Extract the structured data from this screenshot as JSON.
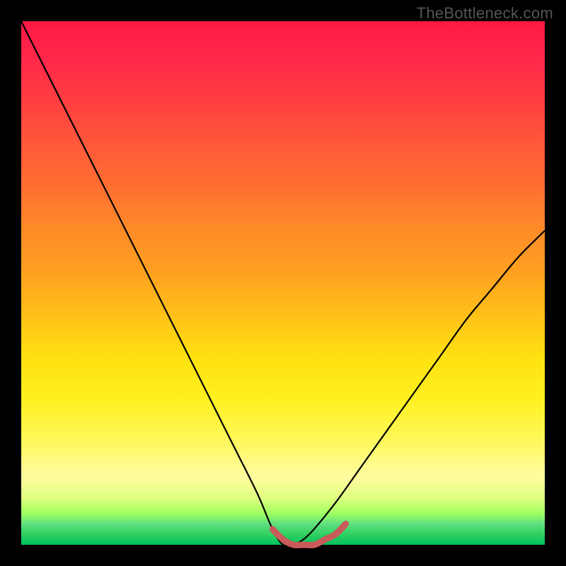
{
  "watermark": "TheBottleneck.com",
  "chart_data": {
    "type": "line",
    "title": "",
    "xlabel": "",
    "ylabel": "",
    "xlim": [
      0,
      1
    ],
    "ylim": [
      0,
      1
    ],
    "grid": false,
    "series": [
      {
        "name": "main-curve",
        "color": "#000000",
        "x": [
          0.0,
          0.05,
          0.1,
          0.15,
          0.2,
          0.25,
          0.3,
          0.35,
          0.4,
          0.45,
          0.48,
          0.5,
          0.52,
          0.55,
          0.6,
          0.65,
          0.7,
          0.75,
          0.8,
          0.85,
          0.9,
          0.95,
          1.0
        ],
        "y": [
          1.0,
          0.9,
          0.8,
          0.7,
          0.6,
          0.5,
          0.4,
          0.3,
          0.2,
          0.1,
          0.03,
          0.0,
          0.0,
          0.02,
          0.08,
          0.15,
          0.22,
          0.29,
          0.36,
          0.43,
          0.49,
          0.55,
          0.6
        ]
      },
      {
        "name": "bottom-highlight",
        "color": "#c85a5a",
        "x": [
          0.48,
          0.5,
          0.52,
          0.54,
          0.56,
          0.58,
          0.6,
          0.62
        ],
        "y": [
          0.03,
          0.01,
          0.0,
          0.0,
          0.0,
          0.01,
          0.02,
          0.04
        ]
      }
    ]
  }
}
